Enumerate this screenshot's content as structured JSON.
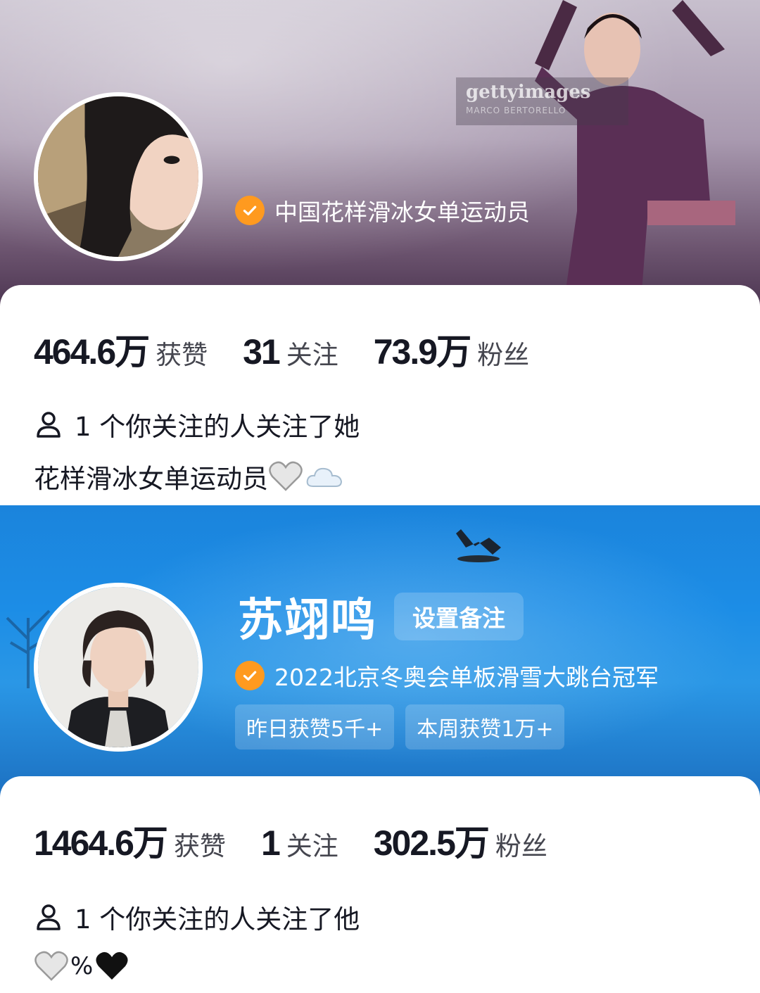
{
  "profile1": {
    "header_watermark": {
      "brand": "gettyimages",
      "credit": "MARCO BERTORELLO"
    },
    "verified_title": "中国花样滑冰女单运动员",
    "stats": [
      {
        "value": "464.6万",
        "label": "获赞"
      },
      {
        "value": "31",
        "label": "关注"
      },
      {
        "value": "73.9万",
        "label": "粉丝"
      }
    ],
    "mutual_text": "1 个你关注的人关注了她",
    "bio_text": "花样滑冰女单运动员",
    "bio_emojis": [
      "white-heart-icon",
      "cloud-icon"
    ]
  },
  "profile2": {
    "name": "苏翊鸣",
    "remark_button": "设置备注",
    "verified_title": "2022北京冬奥会单板滑雪大跳台冠军",
    "tags": [
      "昨日获赞5千+",
      "本周获赞1万+"
    ],
    "stats": [
      {
        "value": "1464.6万",
        "label": "获赞"
      },
      {
        "value": "1",
        "label": "关注"
      },
      {
        "value": "302.5万",
        "label": "粉丝"
      }
    ],
    "mutual_text": "1 个你关注的人关注了他",
    "bio_text": "%",
    "bio_emojis": [
      "white-heart-icon",
      "black-heart-icon"
    ]
  },
  "colors": {
    "verified_badge": "#ff9a1f",
    "profile1_header": "#a99ab0",
    "profile2_header": "#1c8de6",
    "stat_number": "#161823"
  }
}
